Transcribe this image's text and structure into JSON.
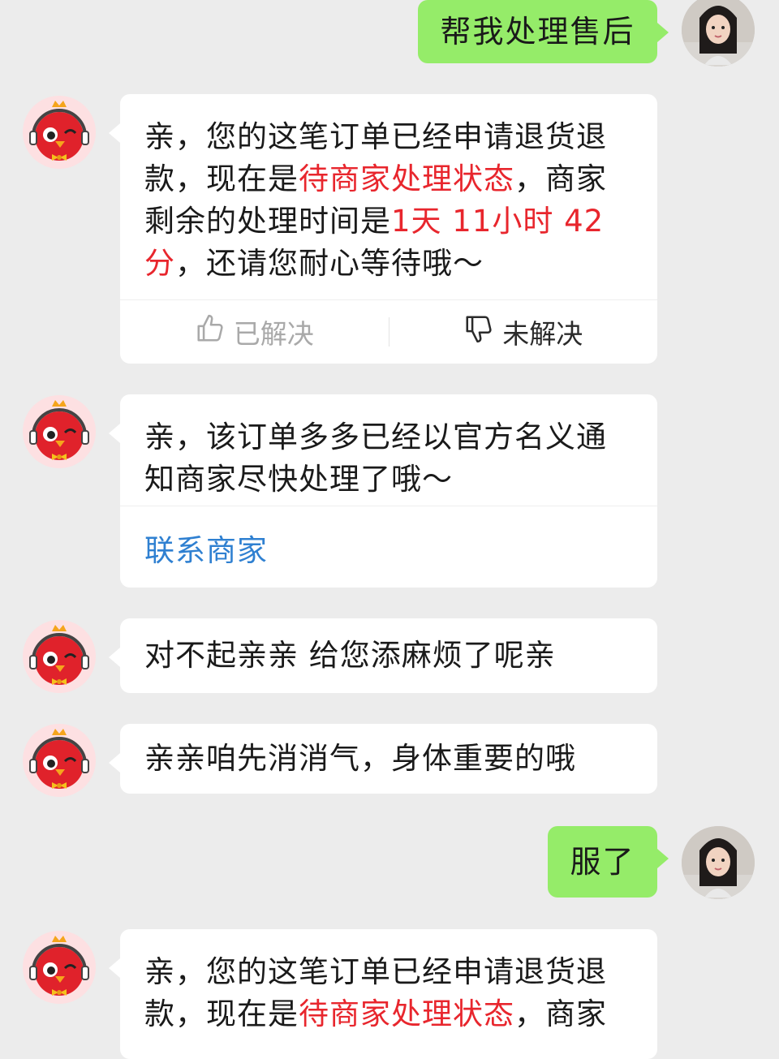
{
  "messages": [
    {
      "sender": "user",
      "text": "帮我处理售后"
    },
    {
      "sender": "bot",
      "segments": [
        "亲，您的这笔订单已经申请退货退款，现在是",
        "待商家处理状态",
        "，商家剩余的处理时间是",
        "1天 11小时 42分",
        "，还请您耐心等待哦～"
      ],
      "feedback": {
        "resolved": "已解决",
        "unresolved": "未解决",
        "resolved_icon": "thumbs-up-icon",
        "unresolved_icon": "thumbs-down-icon"
      }
    },
    {
      "sender": "bot",
      "text": "亲，该订单多多已经以官方名义通知商家尽快处理了哦～",
      "action": "联系商家"
    },
    {
      "sender": "bot",
      "text": "对不起亲亲 给您添麻烦了呢亲"
    },
    {
      "sender": "bot",
      "text": "亲亲咱先消消气，身体重要的哦"
    },
    {
      "sender": "user",
      "text": "服了"
    },
    {
      "sender": "bot",
      "segments": [
        "亲，您的这笔订单已经申请退货退款，现在是",
        "待商家处理状态",
        "，商家"
      ]
    }
  ],
  "colors": {
    "background": "#ececec",
    "user_bubble": "#95ec69",
    "bot_bubble": "#ffffff",
    "highlight_red": "#e8262d",
    "link_blue": "#2f80d1"
  },
  "avatars": {
    "bot": "chick-mascot-headset",
    "user": "user-photo"
  }
}
